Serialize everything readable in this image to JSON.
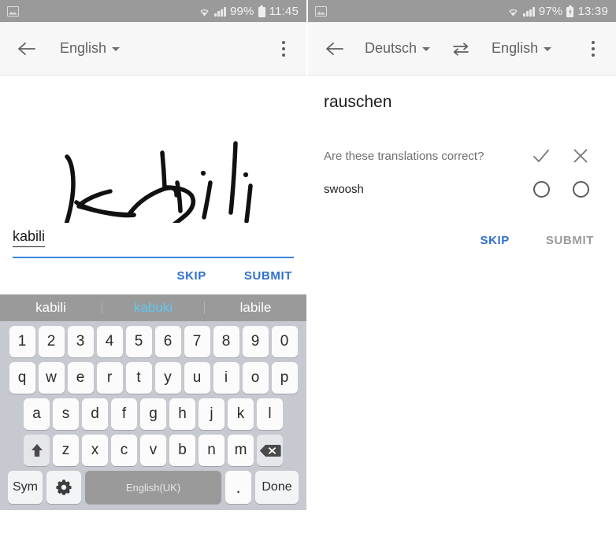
{
  "left": {
    "status_bar": {
      "notification_icon": "screenshot-image-icon",
      "wifi_icon": "wifi-icon",
      "signal_icon": "cellular-signal-icon",
      "battery_percent": "99%",
      "battery_icon": "battery-full-icon",
      "time": "11:45"
    },
    "toolbar": {
      "back_icon": "back-arrow-icon",
      "language": "English",
      "dropdown_icon": "caret-down-icon",
      "overflow_icon": "overflow-menu-icon"
    },
    "handwriting": {
      "label": "handwritten-word-kabili"
    },
    "input": {
      "value": "kabili",
      "placeholder": ""
    },
    "actions": {
      "skip": "SKIP",
      "submit": "SUBMIT"
    },
    "suggestions": [
      {
        "text": "kabili",
        "selected": false
      },
      {
        "text": "kabuki",
        "selected": true
      },
      {
        "text": "labile",
        "selected": false
      }
    ],
    "keyboard": {
      "row1": [
        "1",
        "2",
        "3",
        "4",
        "5",
        "6",
        "7",
        "8",
        "9",
        "0"
      ],
      "row2": [
        "q",
        "w",
        "e",
        "r",
        "t",
        "y",
        "u",
        "i",
        "o",
        "p"
      ],
      "row3": [
        "a",
        "s",
        "d",
        "f",
        "g",
        "h",
        "j",
        "k",
        "l"
      ],
      "row4": [
        "z",
        "x",
        "c",
        "v",
        "b",
        "n",
        "m"
      ],
      "shift_icon": "shift-arrow-up-icon",
      "backspace_icon": "backspace-icon",
      "sym_label": "Sym",
      "settings_icon": "gear-icon",
      "space_label": "English(UK)",
      "period_label": ".",
      "done_label": "Done"
    }
  },
  "right": {
    "status_bar": {
      "notification_icon": "screenshot-image-icon",
      "wifi_icon": "wifi-icon",
      "signal_icon": "cellular-signal-icon",
      "battery_percent": "97%",
      "battery_icon": "battery-charging-icon",
      "time": "13:39"
    },
    "toolbar": {
      "back_icon": "back-arrow-icon",
      "source_language": "Deutsch",
      "swap_icon": "swap-horizontal-icon",
      "target_language": "English",
      "dropdown_icon": "caret-down-icon",
      "overflow_icon": "overflow-menu-icon"
    },
    "content": {
      "word": "rauschen",
      "question": "Are these translations correct?",
      "check_icon": "check-icon",
      "cross_icon": "close-x-icon",
      "translations": [
        {
          "text": "swoosh",
          "yes_selected": false,
          "no_selected": false
        }
      ]
    },
    "actions": {
      "skip": "SKIP",
      "submit": "SUBMIT"
    }
  },
  "colors": {
    "accent_blue": "#2f6fd0",
    "suggestion_selected": "#5ec8ee",
    "status_bar_gray": "#9a9a9a",
    "keyboard_bg": "#c6c9cf",
    "disabled_gray": "#9a9a9a"
  }
}
